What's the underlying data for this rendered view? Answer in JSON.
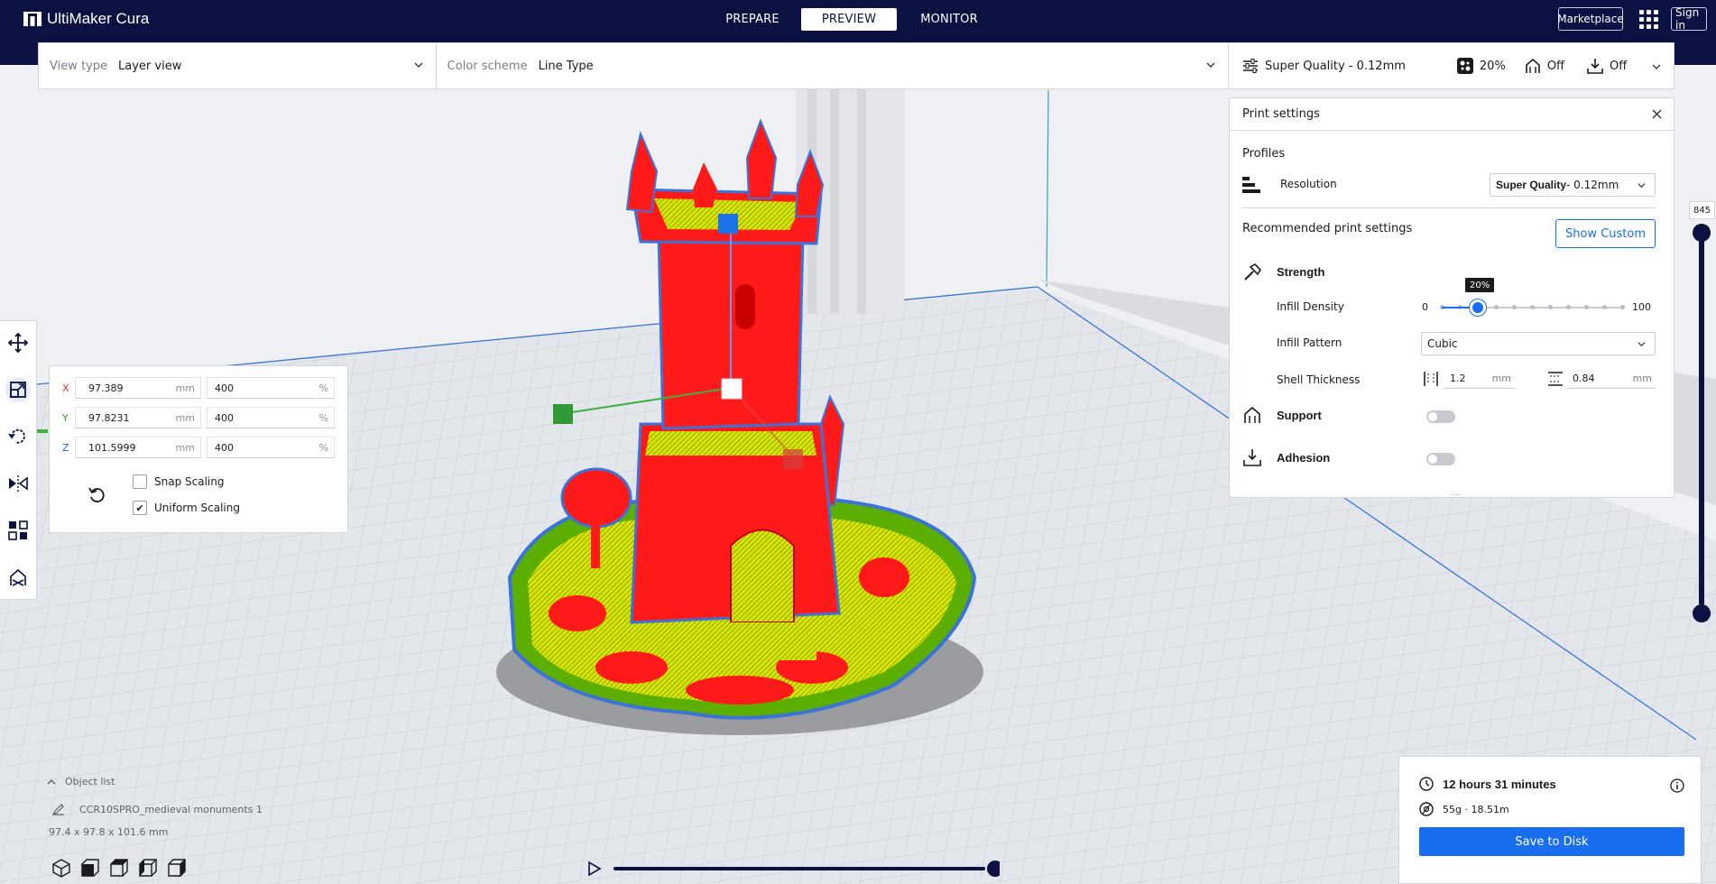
{
  "app": {
    "title": "UltiMaker Cura"
  },
  "stages": {
    "prepare": "PREPARE",
    "preview": "PREVIEW",
    "monitor": "MONITOR"
  },
  "topbar": {
    "marketplace": "Marketplace",
    "signin": "Sign in"
  },
  "viewbar": {
    "view_type_label": "View type",
    "view_type_value": "Layer view",
    "color_scheme_label": "Color scheme",
    "color_scheme_value": "Line Type"
  },
  "quickbar": {
    "profile": "Super Quality - 0.12mm",
    "infill": "20%",
    "support": "Off",
    "adhesion": "Off"
  },
  "print_settings": {
    "title": "Print settings",
    "profiles_label": "Profiles",
    "resolution_label": "Resolution",
    "resolution_bold": "Super Quality",
    "resolution_rest": " - 0.12mm",
    "recommended_label": "Recommended print settings",
    "show_custom": "Show Custom",
    "strength_label": "Strength",
    "infill_density_label": "Infill Density",
    "infill_min": "0",
    "infill_max": "100",
    "infill_value_label": "20%",
    "infill_value": 20,
    "infill_pattern_label": "Infill Pattern",
    "infill_pattern_value": "Cubic",
    "shell_thickness_label": "Shell Thickness",
    "wall_value": "1.2",
    "topbottom_value": "0.84",
    "unit_mm": "mm",
    "support_label": "Support",
    "adhesion_label": "Adhesion"
  },
  "scale_panel": {
    "x_label": "X",
    "y_label": "Y",
    "z_label": "Z",
    "x_mm": "97.389",
    "y_mm": "97.8231",
    "z_mm": "101.5999",
    "x_pct": "400",
    "y_pct": "400",
    "z_pct": "400",
    "unit_mm": "mm",
    "unit_pct": "%",
    "snap_scaling": "Snap Scaling",
    "uniform_scaling": "Uniform Scaling",
    "uniform_checked_mark": "✔"
  },
  "layer_slider": {
    "top_layer": "845"
  },
  "object_list": {
    "title": "Object list",
    "item": "CCR10SPRO_medieval monuments 1",
    "dimensions": "97.4 x 97.8 x 101.6 mm"
  },
  "estimate": {
    "time": "12 hours 31 minutes",
    "material": "55g · 18.51m",
    "save": "Save to Disk"
  },
  "colors": {
    "brand_dark": "#0b1140",
    "accent_blue": "#196ef0",
    "wall_red": "#ff1a1a",
    "infill_yellow": "#d8e600",
    "skin_green": "#5cae00",
    "outline_blue": "#3a74d9"
  }
}
